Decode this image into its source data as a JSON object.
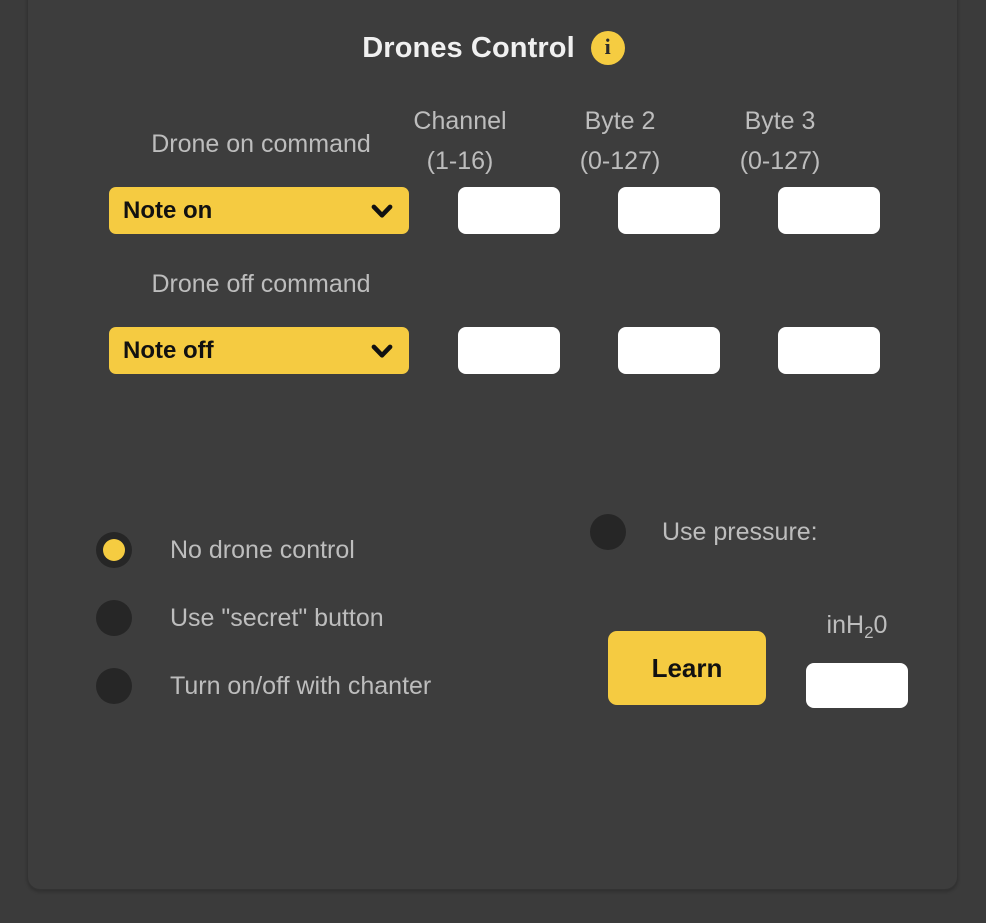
{
  "panel": {
    "title": "Drones Control",
    "info_icon_label": "i",
    "accent_color": "#f5cb41",
    "background_color": "#3d3d3d",
    "text_color": "#bdbdbd"
  },
  "columns": [
    {
      "name": "Channel",
      "range": "(1-16)"
    },
    {
      "name": "Byte 2",
      "range": "(0-127)"
    },
    {
      "name": "Byte 3",
      "range": "(0-127)"
    }
  ],
  "rows": [
    {
      "label": "Drone on command",
      "command": "Note on",
      "channel": "",
      "byte2": "",
      "byte3": ""
    },
    {
      "label": "Drone off command",
      "command": "Note off",
      "channel": "",
      "byte2": "",
      "byte3": ""
    }
  ],
  "drone_mode": {
    "options": [
      {
        "label": "No drone control",
        "selected": true
      },
      {
        "label": "Use \"secret\" button",
        "selected": false
      },
      {
        "label": "Turn on/off with chanter",
        "selected": false
      }
    ]
  },
  "pressure": {
    "label": "Use pressure:",
    "selected": false,
    "learn_label": "Learn",
    "unit_prefix": "inH",
    "unit_sub": "2",
    "unit_suffix": "0",
    "value": ""
  }
}
